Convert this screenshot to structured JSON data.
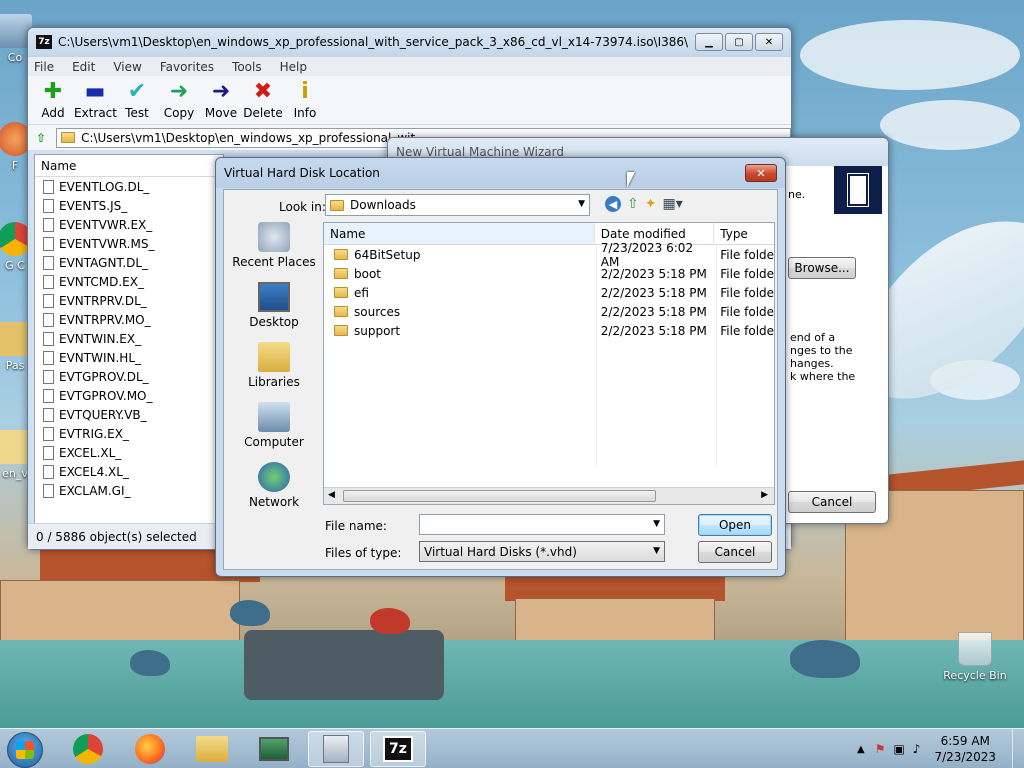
{
  "desktop": {
    "icons": [
      {
        "label": "Co"
      },
      {
        "label": "F"
      },
      {
        "label": "G C"
      },
      {
        "label": "Pas"
      },
      {
        "label": "en_v"
      },
      {
        "label": "Recycle Bin"
      }
    ]
  },
  "sevenzip": {
    "title": "C:\\Users\\vm1\\Desktop\\en_windows_xp_professional_with_service_pack_3_x86_cd_vl_x14-73974.iso\\I386\\",
    "app_icon": "7z",
    "menu": [
      "File",
      "Edit",
      "View",
      "Favorites",
      "Tools",
      "Help"
    ],
    "toolbar": [
      {
        "label": "Add",
        "icon": "plus-icon",
        "glyph": "✚",
        "color": "#1aa31a"
      },
      {
        "label": "Extract",
        "icon": "minus-icon",
        "glyph": "▬",
        "color": "#1a2aa8"
      },
      {
        "label": "Test",
        "icon": "check-icon",
        "glyph": "✔",
        "color": "#29b3b3"
      },
      {
        "label": "Copy",
        "icon": "copy-arrow-icon",
        "glyph": "➜",
        "color": "#1aa35a"
      },
      {
        "label": "Move",
        "icon": "move-arrow-icon",
        "glyph": "➜",
        "color": "#1a1a8a"
      },
      {
        "label": "Delete",
        "icon": "delete-x-icon",
        "glyph": "✖",
        "color": "#d01a1a"
      },
      {
        "label": "Info",
        "icon": "info-icon",
        "glyph": "i",
        "color": "#c9a000"
      }
    ],
    "address": "C:\\Users\\vm1\\Desktop\\en_windows_xp_professional_wit",
    "column_name": "Name",
    "files": [
      "EVENTLOG.DL_",
      "EVENTS.JS_",
      "EVENTVWR.EX_",
      "EVENTVWR.MS_",
      "EVNTAGNT.DL_",
      "EVNTCMD.EX_",
      "EVNTRPRV.DL_",
      "EVNTRPRV.MO_",
      "EVNTWIN.EX_",
      "EVNTWIN.HL_",
      "EVTGPROV.DL_",
      "EVTGPROV.MO_",
      "EVTQUERY.VB_",
      "EVTRIG.EX_",
      "EXCEL.XL_",
      "EXCEL4.XL_",
      "EXCLAM.GI_"
    ],
    "status": "0 / 5886 object(s) selected"
  },
  "wizard": {
    "title": "New Virtual Machine Wizard",
    "text_top": "ne.",
    "browse": "Browse...",
    "text_body": [
      "end of a",
      "nges to the",
      "hanges.",
      "k where the"
    ],
    "cancel": "Cancel"
  },
  "dialog": {
    "title": "Virtual Hard Disk Location",
    "close": "x",
    "look_in_label": "Look in:",
    "look_in_value": "Downloads",
    "places": [
      "Recent Places",
      "Desktop",
      "Libraries",
      "Computer",
      "Network"
    ],
    "columns": {
      "name": "Name",
      "date": "Date modified",
      "type": "Type"
    },
    "rows": [
      {
        "name": "64BitSetup",
        "date": "7/23/2023 6:02 AM",
        "type": "File folder"
      },
      {
        "name": "boot",
        "date": "2/2/2023 5:18 PM",
        "type": "File folder"
      },
      {
        "name": "efi",
        "date": "2/2/2023 5:18 PM",
        "type": "File folder"
      },
      {
        "name": "sources",
        "date": "2/2/2023 5:18 PM",
        "type": "File folder"
      },
      {
        "name": "support",
        "date": "2/2/2023 5:18 PM",
        "type": "File folder"
      }
    ],
    "file_name_label": "File name:",
    "file_name_value": "",
    "file_type_label": "Files of type:",
    "file_type_value": "Virtual Hard Disks (*.vhd)",
    "open": "Open",
    "cancel": "Cancel"
  },
  "taskbar": {
    "apps": [
      "chrome-icon",
      "firefox-icon",
      "explorer-icon",
      "monitor-tool-icon",
      "virtual-pc-icon",
      "7zip-icon"
    ],
    "app_7z_label": "7z",
    "time": "6:59 AM",
    "date": "7/23/2023"
  }
}
